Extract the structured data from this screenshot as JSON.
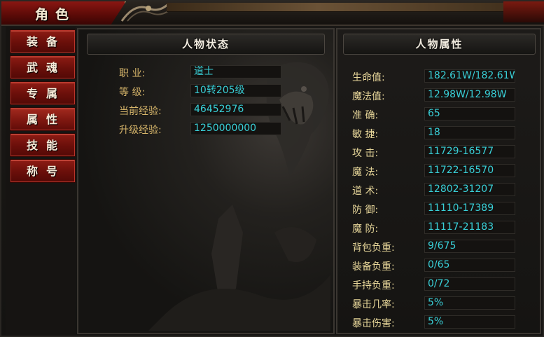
{
  "window": {
    "title": "角色"
  },
  "sidebar": {
    "items": [
      {
        "label": "装备"
      },
      {
        "label": "武魂"
      },
      {
        "label": "专属"
      },
      {
        "label": "属性"
      },
      {
        "label": "技能"
      },
      {
        "label": "称号"
      }
    ],
    "active_index": 3
  },
  "status_panel": {
    "header": "人物状态",
    "rows": [
      {
        "label": "职  业:",
        "value": "道士"
      },
      {
        "label": "等  级:",
        "value": "10转205级"
      },
      {
        "label": "当前经验:",
        "value": "46452976"
      },
      {
        "label": "升级经验:",
        "value": "1250000000"
      }
    ]
  },
  "attr_panel": {
    "header": "人物属性",
    "rows": [
      {
        "label": "生命值:",
        "value": "182.61W/182.61W"
      },
      {
        "label": "魔法值:",
        "value": "12.98W/12.98W"
      },
      {
        "label": "准  确:",
        "value": "65"
      },
      {
        "label": "敏  捷:",
        "value": "18"
      },
      {
        "label": "攻  击:",
        "value": "11729-16577"
      },
      {
        "label": "魔  法:",
        "value": "11722-16570"
      },
      {
        "label": "道  术:",
        "value": "12802-31207"
      },
      {
        "label": "防  御:",
        "value": "11110-17389"
      },
      {
        "label": "魔  防:",
        "value": "11117-21183"
      },
      {
        "label": "背包负重:",
        "value": "9/675"
      },
      {
        "label": "装备负重:",
        "value": "0/65"
      },
      {
        "label": "手持负重:",
        "value": "0/72"
      },
      {
        "label": "暴击几率:",
        "value": "5%"
      },
      {
        "label": "暴击伤害:",
        "value": "5%"
      }
    ]
  },
  "colors": {
    "accent_red": "#8e1c14",
    "label_gold": "#d6b56a",
    "value_cyan": "#39d0d8"
  }
}
